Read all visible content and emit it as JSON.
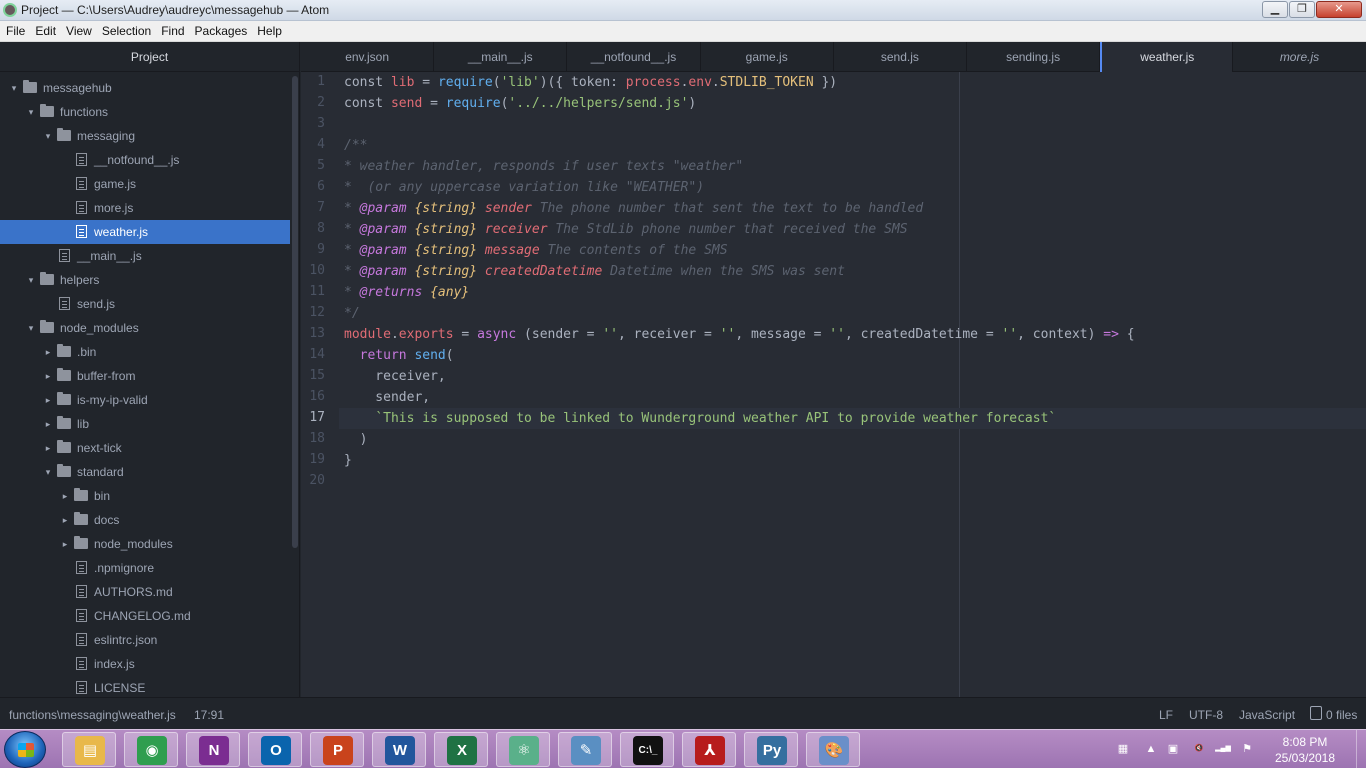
{
  "window": {
    "title": "Project — C:\\Users\\Audrey\\audreyc\\messagehub — Atom",
    "minimize_glyph": "▁",
    "maximize_glyph": "❐",
    "close_glyph": "✕"
  },
  "menu": [
    "File",
    "Edit",
    "View",
    "Selection",
    "Find",
    "Packages",
    "Help"
  ],
  "sidebar": {
    "title": "Project",
    "tree": [
      {
        "label": "messagehub",
        "type": "folder",
        "depth": 0,
        "expanded": true
      },
      {
        "label": "functions",
        "type": "folder",
        "depth": 1,
        "expanded": true
      },
      {
        "label": "messaging",
        "type": "folder",
        "depth": 2,
        "expanded": true
      },
      {
        "label": "__notfound__.js",
        "type": "file",
        "depth": 3
      },
      {
        "label": "game.js",
        "type": "file",
        "depth": 3
      },
      {
        "label": "more.js",
        "type": "file",
        "depth": 3
      },
      {
        "label": "weather.js",
        "type": "file",
        "depth": 3,
        "selected": true
      },
      {
        "label": "__main__.js",
        "type": "file",
        "depth": 2
      },
      {
        "label": "helpers",
        "type": "folder",
        "depth": 1,
        "expanded": true
      },
      {
        "label": "send.js",
        "type": "file",
        "depth": 2
      },
      {
        "label": "node_modules",
        "type": "folder",
        "depth": 1,
        "expanded": true
      },
      {
        "label": ".bin",
        "type": "folder",
        "depth": 2,
        "expanded": false
      },
      {
        "label": "buffer-from",
        "type": "folder",
        "depth": 2,
        "expanded": false
      },
      {
        "label": "is-my-ip-valid",
        "type": "folder",
        "depth": 2,
        "expanded": false
      },
      {
        "label": "lib",
        "type": "folder",
        "depth": 2,
        "expanded": false
      },
      {
        "label": "next-tick",
        "type": "folder",
        "depth": 2,
        "expanded": false
      },
      {
        "label": "standard",
        "type": "folder",
        "depth": 2,
        "expanded": true
      },
      {
        "label": "bin",
        "type": "folder",
        "depth": 3,
        "expanded": false
      },
      {
        "label": "docs",
        "type": "folder",
        "depth": 3,
        "expanded": false
      },
      {
        "label": "node_modules",
        "type": "folder",
        "depth": 3,
        "expanded": false
      },
      {
        "label": ".npmignore",
        "type": "file",
        "depth": 3
      },
      {
        "label": "AUTHORS.md",
        "type": "file",
        "depth": 3
      },
      {
        "label": "CHANGELOG.md",
        "type": "file",
        "depth": 3
      },
      {
        "label": "eslintrc.json",
        "type": "file",
        "depth": 3
      },
      {
        "label": "index.js",
        "type": "file",
        "depth": 3
      },
      {
        "label": "LICENSE",
        "type": "file",
        "depth": 3
      }
    ]
  },
  "tabs": [
    {
      "label": "env.json"
    },
    {
      "label": "__main__.js"
    },
    {
      "label": "__notfound__.js"
    },
    {
      "label": "game.js"
    },
    {
      "label": "send.js"
    },
    {
      "label": "sending.js"
    },
    {
      "label": "weather.js",
      "active": true
    },
    {
      "label": "more.js",
      "preview": true
    }
  ],
  "editor": {
    "current_line": 17,
    "lines": [
      [
        [
          "pl",
          "const "
        ],
        [
          "var",
          "lib"
        ],
        [
          "pl",
          " = "
        ],
        [
          "fn",
          "require"
        ],
        [
          "pl",
          "("
        ],
        [
          "str",
          "'lib'"
        ],
        [
          "pl",
          ")({ token: "
        ],
        [
          "var",
          "process"
        ],
        [
          "pl",
          "."
        ],
        [
          "prop",
          "env"
        ],
        [
          "pl",
          "."
        ],
        [
          "cst",
          "STDLIB_TOKEN"
        ],
        [
          "pl",
          " })"
        ]
      ],
      [
        [
          "pl",
          "const "
        ],
        [
          "var",
          "send"
        ],
        [
          "pl",
          " = "
        ],
        [
          "fn",
          "require"
        ],
        [
          "pl",
          "("
        ],
        [
          "str",
          "'../../helpers/send.js'"
        ],
        [
          "pl",
          ")"
        ]
      ],
      [],
      [
        [
          "cmt",
          "/**"
        ]
      ],
      [
        [
          "cmt",
          "* weather handler, responds if user texts \"weather\""
        ]
      ],
      [
        [
          "cmt",
          "*  (or any uppercase variation like \"WEATHER\")"
        ]
      ],
      [
        [
          "cmt",
          "* "
        ],
        [
          "dcw",
          "@param"
        ],
        [
          "cmt",
          " "
        ],
        [
          "dct",
          "{string}"
        ],
        [
          "cmt",
          " "
        ],
        [
          "dcn",
          "sender"
        ],
        [
          "cmt",
          " The phone number that sent the text to be handled"
        ]
      ],
      [
        [
          "cmt",
          "* "
        ],
        [
          "dcw",
          "@param"
        ],
        [
          "cmt",
          " "
        ],
        [
          "dct",
          "{string}"
        ],
        [
          "cmt",
          " "
        ],
        [
          "dcn",
          "receiver"
        ],
        [
          "cmt",
          " The StdLib phone number that received the SMS"
        ]
      ],
      [
        [
          "cmt",
          "* "
        ],
        [
          "dcw",
          "@param"
        ],
        [
          "cmt",
          " "
        ],
        [
          "dct",
          "{string}"
        ],
        [
          "cmt",
          " "
        ],
        [
          "dcn",
          "message"
        ],
        [
          "cmt",
          " The contents of the SMS"
        ]
      ],
      [
        [
          "cmt",
          "* "
        ],
        [
          "dcw",
          "@param"
        ],
        [
          "cmt",
          " "
        ],
        [
          "dct",
          "{string}"
        ],
        [
          "cmt",
          " "
        ],
        [
          "dcn",
          "createdDatetime"
        ],
        [
          "cmt",
          " Datetime when the SMS was sent"
        ]
      ],
      [
        [
          "cmt",
          "* "
        ],
        [
          "dcw",
          "@returns"
        ],
        [
          "cmt",
          " "
        ],
        [
          "dct",
          "{any}"
        ]
      ],
      [
        [
          "cmt",
          "*/"
        ]
      ],
      [
        [
          "var",
          "module"
        ],
        [
          "pl",
          "."
        ],
        [
          "prop",
          "exports"
        ],
        [
          "pl",
          " = "
        ],
        [
          "kw",
          "async"
        ],
        [
          "pl",
          " (sender = "
        ],
        [
          "str",
          "''"
        ],
        [
          "pl",
          ", receiver = "
        ],
        [
          "str",
          "''"
        ],
        [
          "pl",
          ", message = "
        ],
        [
          "str",
          "''"
        ],
        [
          "pl",
          ", createdDatetime = "
        ],
        [
          "str",
          "''"
        ],
        [
          "pl",
          ", context) "
        ],
        [
          "kw",
          "=>"
        ],
        [
          "pl",
          " {"
        ]
      ],
      [
        [
          "pl",
          "  "
        ],
        [
          "kw",
          "return"
        ],
        [
          "pl",
          " "
        ],
        [
          "fn",
          "send"
        ],
        [
          "pl",
          "("
        ]
      ],
      [
        [
          "pl",
          "    receiver,"
        ]
      ],
      [
        [
          "pl",
          "    sender,"
        ]
      ],
      [
        [
          "pl",
          "    "
        ],
        [
          "str",
          "`This is supposed to be linked to Wunderground weather API to provide weather forecast`"
        ]
      ],
      [
        [
          "pl",
          "  )"
        ]
      ],
      [
        [
          "pl",
          "}"
        ]
      ],
      []
    ]
  },
  "status": {
    "path": "functions\\messaging\\weather.js",
    "cursor": "17:91",
    "line_ending": "LF",
    "encoding": "UTF-8",
    "grammar": "JavaScript",
    "git": "0 files"
  },
  "taskbar": {
    "apps": [
      {
        "name": "file-explorer",
        "glyph": "▤",
        "color": "#e8b84a"
      },
      {
        "name": "chrome",
        "glyph": "◉",
        "color": "#2f9e4f"
      },
      {
        "name": "onenote",
        "glyph": "N",
        "color": "#7b2d91"
      },
      {
        "name": "outlook",
        "glyph": "O",
        "color": "#0a64ad"
      },
      {
        "name": "powerpoint",
        "glyph": "P",
        "color": "#c9431c"
      },
      {
        "name": "word",
        "glyph": "W",
        "color": "#22569c"
      },
      {
        "name": "excel",
        "glyph": "X",
        "color": "#1f7244"
      },
      {
        "name": "atom",
        "glyph": "⚛",
        "color": "#5ab08a"
      },
      {
        "name": "notepad",
        "glyph": "✎",
        "color": "#5a8fc2"
      },
      {
        "name": "cmd",
        "glyph": "C:\\_",
        "color": "#111111"
      },
      {
        "name": "acrobat",
        "glyph": "⅄",
        "color": "#b71c1c"
      },
      {
        "name": "python",
        "glyph": "Py",
        "color": "#356f9f"
      },
      {
        "name": "paint",
        "glyph": "🎨",
        "color": "#6a8fc9"
      }
    ],
    "tray_icons": [
      "▦",
      "▲",
      "▣",
      "🔇",
      "▂▄▆",
      "⚑"
    ],
    "time": "8:08 PM",
    "date": "25/03/2018"
  },
  "colors": {
    "accent": "#568af2",
    "selection": "#3a73c9",
    "editor_bg": "#282c34",
    "panel_bg": "#21252b"
  }
}
